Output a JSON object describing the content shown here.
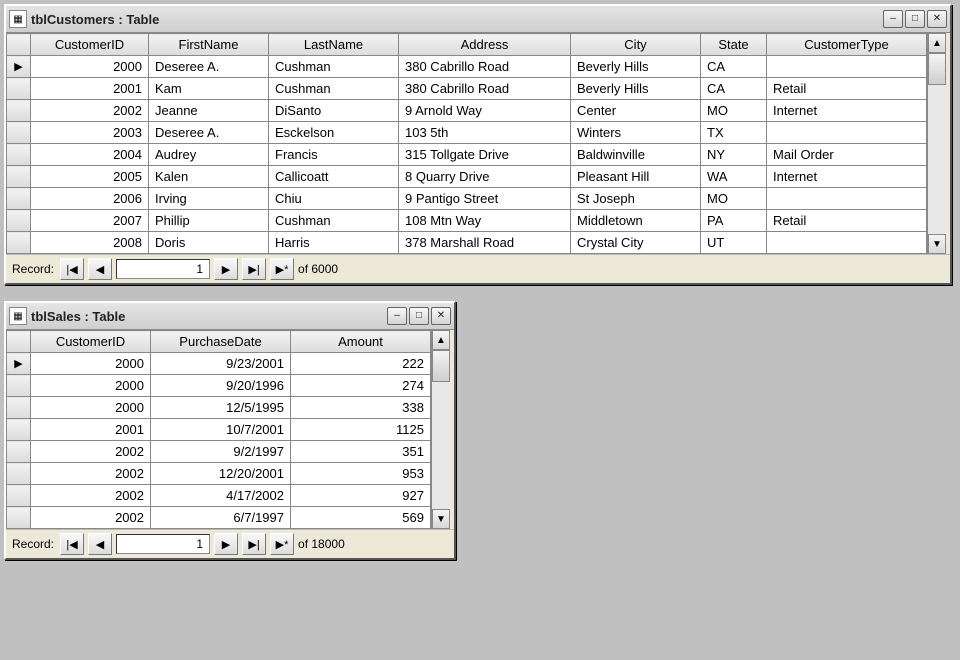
{
  "customers_window": {
    "title": "tblCustomers : Table",
    "columns": [
      "CustomerID",
      "FirstName",
      "LastName",
      "Address",
      "City",
      "State",
      "CustomerType"
    ],
    "rows": [
      {
        "CustomerID": "2000",
        "FirstName": "Deseree A.",
        "LastName": "Cushman",
        "Address": "380 Cabrillo Road",
        "City": "Beverly Hills",
        "State": "CA",
        "CustomerType": ""
      },
      {
        "CustomerID": "2001",
        "FirstName": "Kam",
        "LastName": "Cushman",
        "Address": "380 Cabrillo Road",
        "City": "Beverly Hills",
        "State": "CA",
        "CustomerType": "Retail"
      },
      {
        "CustomerID": "2002",
        "FirstName": "Jeanne",
        "LastName": "DiSanto",
        "Address": "9 Arnold Way",
        "City": "Center",
        "State": "MO",
        "CustomerType": "Internet"
      },
      {
        "CustomerID": "2003",
        "FirstName": "Deseree A.",
        "LastName": "Esckelson",
        "Address": "103 5th",
        "City": "Winters",
        "State": "TX",
        "CustomerType": ""
      },
      {
        "CustomerID": "2004",
        "FirstName": "Audrey",
        "LastName": "Francis",
        "Address": "315 Tollgate Drive",
        "City": "Baldwinville",
        "State": "NY",
        "CustomerType": "Mail Order"
      },
      {
        "CustomerID": "2005",
        "FirstName": "Kalen",
        "LastName": "Callicoatt",
        "Address": "8 Quarry Drive",
        "City": "Pleasant Hill",
        "State": "WA",
        "CustomerType": "Internet"
      },
      {
        "CustomerID": "2006",
        "FirstName": "Irving",
        "LastName": "Chiu",
        "Address": "9 Pantigo Street",
        "City": "St Joseph",
        "State": "MO",
        "CustomerType": ""
      },
      {
        "CustomerID": "2007",
        "FirstName": "Phillip",
        "LastName": "Cushman",
        "Address": "108 Mtn Way",
        "City": "Middletown",
        "State": "PA",
        "CustomerType": "Retail"
      },
      {
        "CustomerID": "2008",
        "FirstName": "Doris",
        "LastName": "Harris",
        "Address": "378 Marshall Road",
        "City": "Crystal City",
        "State": "UT",
        "CustomerType": ""
      }
    ],
    "record_label": "Record:",
    "record_value": "1",
    "record_of": "of  6000"
  },
  "sales_window": {
    "title": "tblSales : Table",
    "columns": [
      "CustomerID",
      "PurchaseDate",
      "Amount"
    ],
    "rows": [
      {
        "CustomerID": "2000",
        "PurchaseDate": "9/23/2001",
        "Amount": "222"
      },
      {
        "CustomerID": "2000",
        "PurchaseDate": "9/20/1996",
        "Amount": "274"
      },
      {
        "CustomerID": "2000",
        "PurchaseDate": "12/5/1995",
        "Amount": "338"
      },
      {
        "CustomerID": "2001",
        "PurchaseDate": "10/7/2001",
        "Amount": "1125"
      },
      {
        "CustomerID": "2002",
        "PurchaseDate": "9/2/1997",
        "Amount": "351"
      },
      {
        "CustomerID": "2002",
        "PurchaseDate": "12/20/2001",
        "Amount": "953"
      },
      {
        "CustomerID": "2002",
        "PurchaseDate": "4/17/2002",
        "Amount": "927"
      },
      {
        "CustomerID": "2002",
        "PurchaseDate": "6/7/1997",
        "Amount": "569"
      }
    ],
    "record_label": "Record:",
    "record_value": "1",
    "record_of": "of  18000"
  },
  "icons": {
    "first": "|◀",
    "prev": "◀",
    "next": "▶",
    "last": "▶|",
    "new": "▶*",
    "up": "▲",
    "down": "▼",
    "min": "–",
    "max": "□",
    "close": "✕",
    "table": "▦",
    "rowmark": "▶"
  }
}
